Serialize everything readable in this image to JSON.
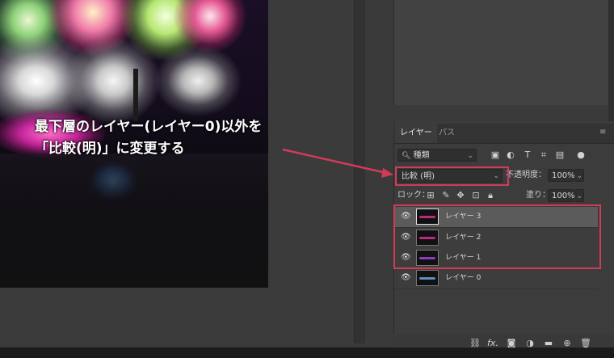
{
  "annotation": {
    "line1": "最下層のレイヤー(レイヤー0)以外を",
    "line2": "「比較(明)」に変更する",
    "color": "#d23b57"
  },
  "layers_panel": {
    "tabs": [
      {
        "label": "レイヤー",
        "active": true
      },
      {
        "label": "パス",
        "active": false
      }
    ],
    "filter": {
      "label": "種類"
    },
    "blend_mode": {
      "value": "比較 (明)"
    },
    "opacity": {
      "label": "不透明度：",
      "value": "100%"
    },
    "lock": {
      "label": "ロック："
    },
    "fill": {
      "label": "塗り：",
      "value": "100%"
    },
    "layers": [
      {
        "name": "レイヤー 3",
        "selected": true
      },
      {
        "name": "レイヤー 2",
        "selected": false
      },
      {
        "name": "レイヤー 1",
        "selected": false
      },
      {
        "name": "レイヤー 0",
        "selected": false
      }
    ],
    "bottom_icons": [
      "link-icon",
      "fx-icon",
      "mask-icon",
      "adjustment-icon",
      "folder-icon",
      "new-layer-icon",
      "trash-icon"
    ],
    "fx_label": "fx."
  }
}
